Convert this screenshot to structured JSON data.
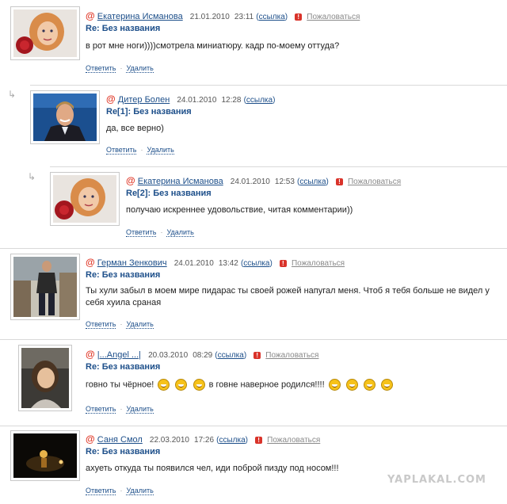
{
  "comments": [
    {
      "author": "Екатерина Исманова",
      "date": "21.01.2010",
      "time": "23:11",
      "link_label": "ссылка",
      "complain_label": "Пожаловаться",
      "title": "Re: Без названия",
      "text": "в рот мне ноги))))смотрела миниатюру. кадр по-моему оттуда?",
      "reply_label": "Ответить",
      "delete_label": "Удалить",
      "avatar": "woman-with-rose"
    },
    {
      "author": "Дитер Болен",
      "date": "24.01.2010",
      "time": "12:28",
      "link_label": "ссылка",
      "title": "Re[1]: Без названия",
      "text": "да, все верно)",
      "reply_label": "Ответить",
      "delete_label": "Удалить",
      "avatar": "man-in-suit"
    },
    {
      "author": "Екатерина Исманова",
      "date": "24.01.2010",
      "time": "12:53",
      "link_label": "ссылка",
      "complain_label": "Пожаловаться",
      "title": "Re[2]: Без названия",
      "text": "получаю искреннее удовольствие, читая комментарии))",
      "reply_label": "Ответить",
      "delete_label": "Удалить",
      "avatar": "woman-with-rose"
    },
    {
      "author": "Герман Зенкович",
      "date": "24.01.2010",
      "time": "13:42",
      "link_label": "ссылка",
      "complain_label": "Пожаловаться",
      "title": "Re: Без названия",
      "text": "Ты хули забыл в моем мире пидарас ты своей рожей напугал меня. Чтоб я тебя больше не видел у себя хуила сраная",
      "reply_label": "Ответить",
      "delete_label": "Удалить",
      "avatar": "man-standing"
    },
    {
      "author": "|...Angel ...|",
      "date": "20.03.2010",
      "time": "08:29",
      "link_label": "ссылка",
      "complain_label": "Пожаловаться",
      "title": "Re: Без названия",
      "text_part1": "говно ты чёрное!",
      "text_part2": "в говне наверное родился!!!!",
      "reply_label": "Ответить",
      "delete_label": "Удалить",
      "avatar": "girl-portrait"
    },
    {
      "author": "Саня Смол",
      "date": "22.03.2010",
      "time": "17:26",
      "link_label": "ссылка",
      "complain_label": "Пожаловаться",
      "title": "Re: Без названия",
      "text": "ахуеть откуда ты появился чел, иди поброй пизду под носом!!!",
      "reply_label": "Ответить",
      "delete_label": "Удалить",
      "avatar": "dark-night-photo"
    }
  ],
  "watermark": "YAPLAKAL.COM",
  "colors": {
    "link": "#1d4f8a",
    "at_sign": "#e03a2a",
    "complain": "#d9332a"
  }
}
